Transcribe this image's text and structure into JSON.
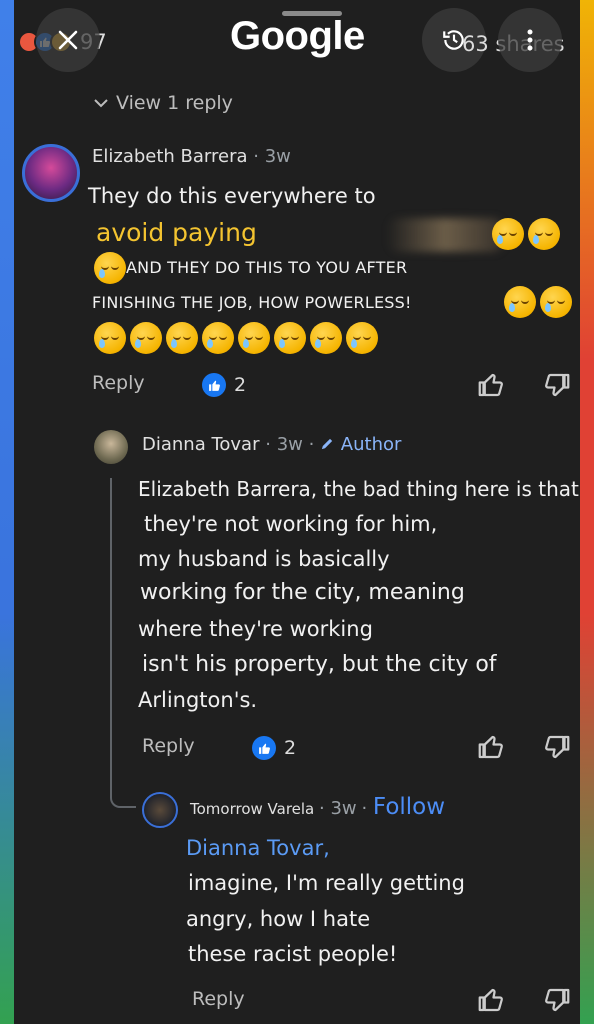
{
  "header": {
    "close_label": "×",
    "logo_text": "Google",
    "reaction_count": "97",
    "shares_text": "63 shares",
    "more_label": "⋮"
  },
  "thread": {
    "view_reply": "View 1 reply"
  },
  "comments": [
    {
      "author": "Elizabeth Barrera",
      "time": "3w",
      "lines": [
        "They do this everywhere to",
        "avoid paying",
        "AND THEY DO THIS TO YOU AFTER",
        "FINISHING THE JOB, HOW POWERLESS!"
      ],
      "reply_label": "Reply",
      "likes": "2"
    },
    {
      "author": "Dianna Tovar",
      "time": "3w",
      "badge": "Author",
      "lines": [
        "Elizabeth Barrera, the bad thing here is that",
        "they're not working for him,",
        "my husband is basically",
        "working for the city, meaning",
        "where they're working",
        "isn't his property, but the city of",
        "Arlington's."
      ],
      "reply_label": "Reply",
      "likes": "2"
    },
    {
      "author": "Tomorrow Varela",
      "time": "3w",
      "follow_label": "Follow",
      "mention": "Dianna Tovar,",
      "lines": [
        "imagine, I'm really getting",
        "angry, how I hate",
        "these racist people!"
      ],
      "reply_label": "Reply"
    }
  ],
  "colors": {
    "background": "#1f1f1f",
    "accent_blue": "#8ab4f8",
    "highlight_yellow": "#f4c430",
    "like_blue": "#1877f2"
  }
}
